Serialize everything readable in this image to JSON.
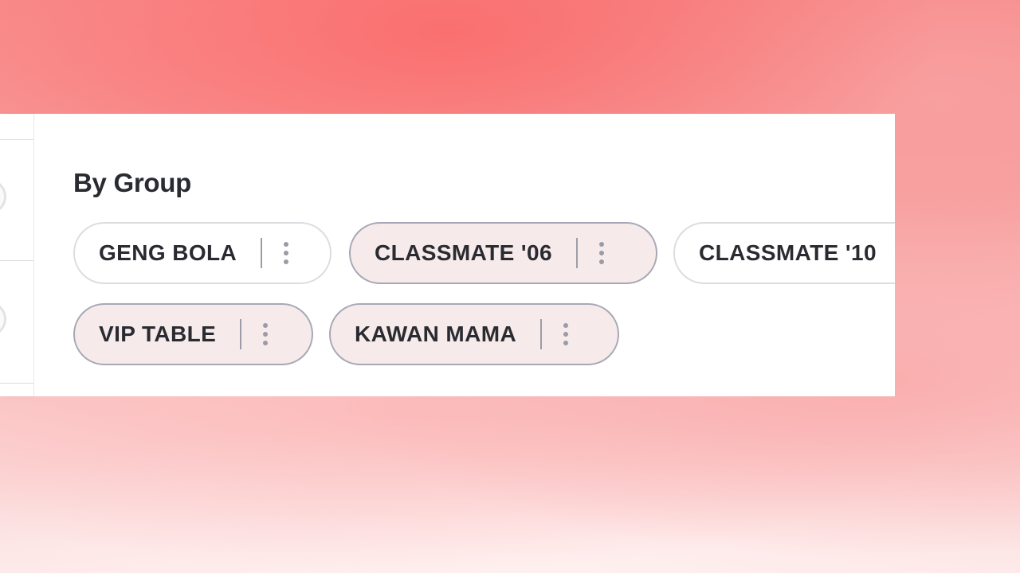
{
  "section": {
    "title": "By Group"
  },
  "groups": [
    {
      "label": "GENG BOLA",
      "style": "plain"
    },
    {
      "label": "CLASSMATE '06",
      "style": "tinted"
    },
    {
      "label": "CLASSMATE '10",
      "style": "plain"
    },
    {
      "label": "VIP TABLE",
      "style": "tinted"
    },
    {
      "label": "KAWAN MAMA",
      "style": "tinted"
    }
  ],
  "icons": {
    "chip_menu": "more-vertical-icon"
  },
  "colors": {
    "chip_tint": "#f6eaea",
    "chip_tint_border": "#a7a8b6",
    "chip_plain_border": "#dcdce1",
    "text": "#2a2b31"
  }
}
